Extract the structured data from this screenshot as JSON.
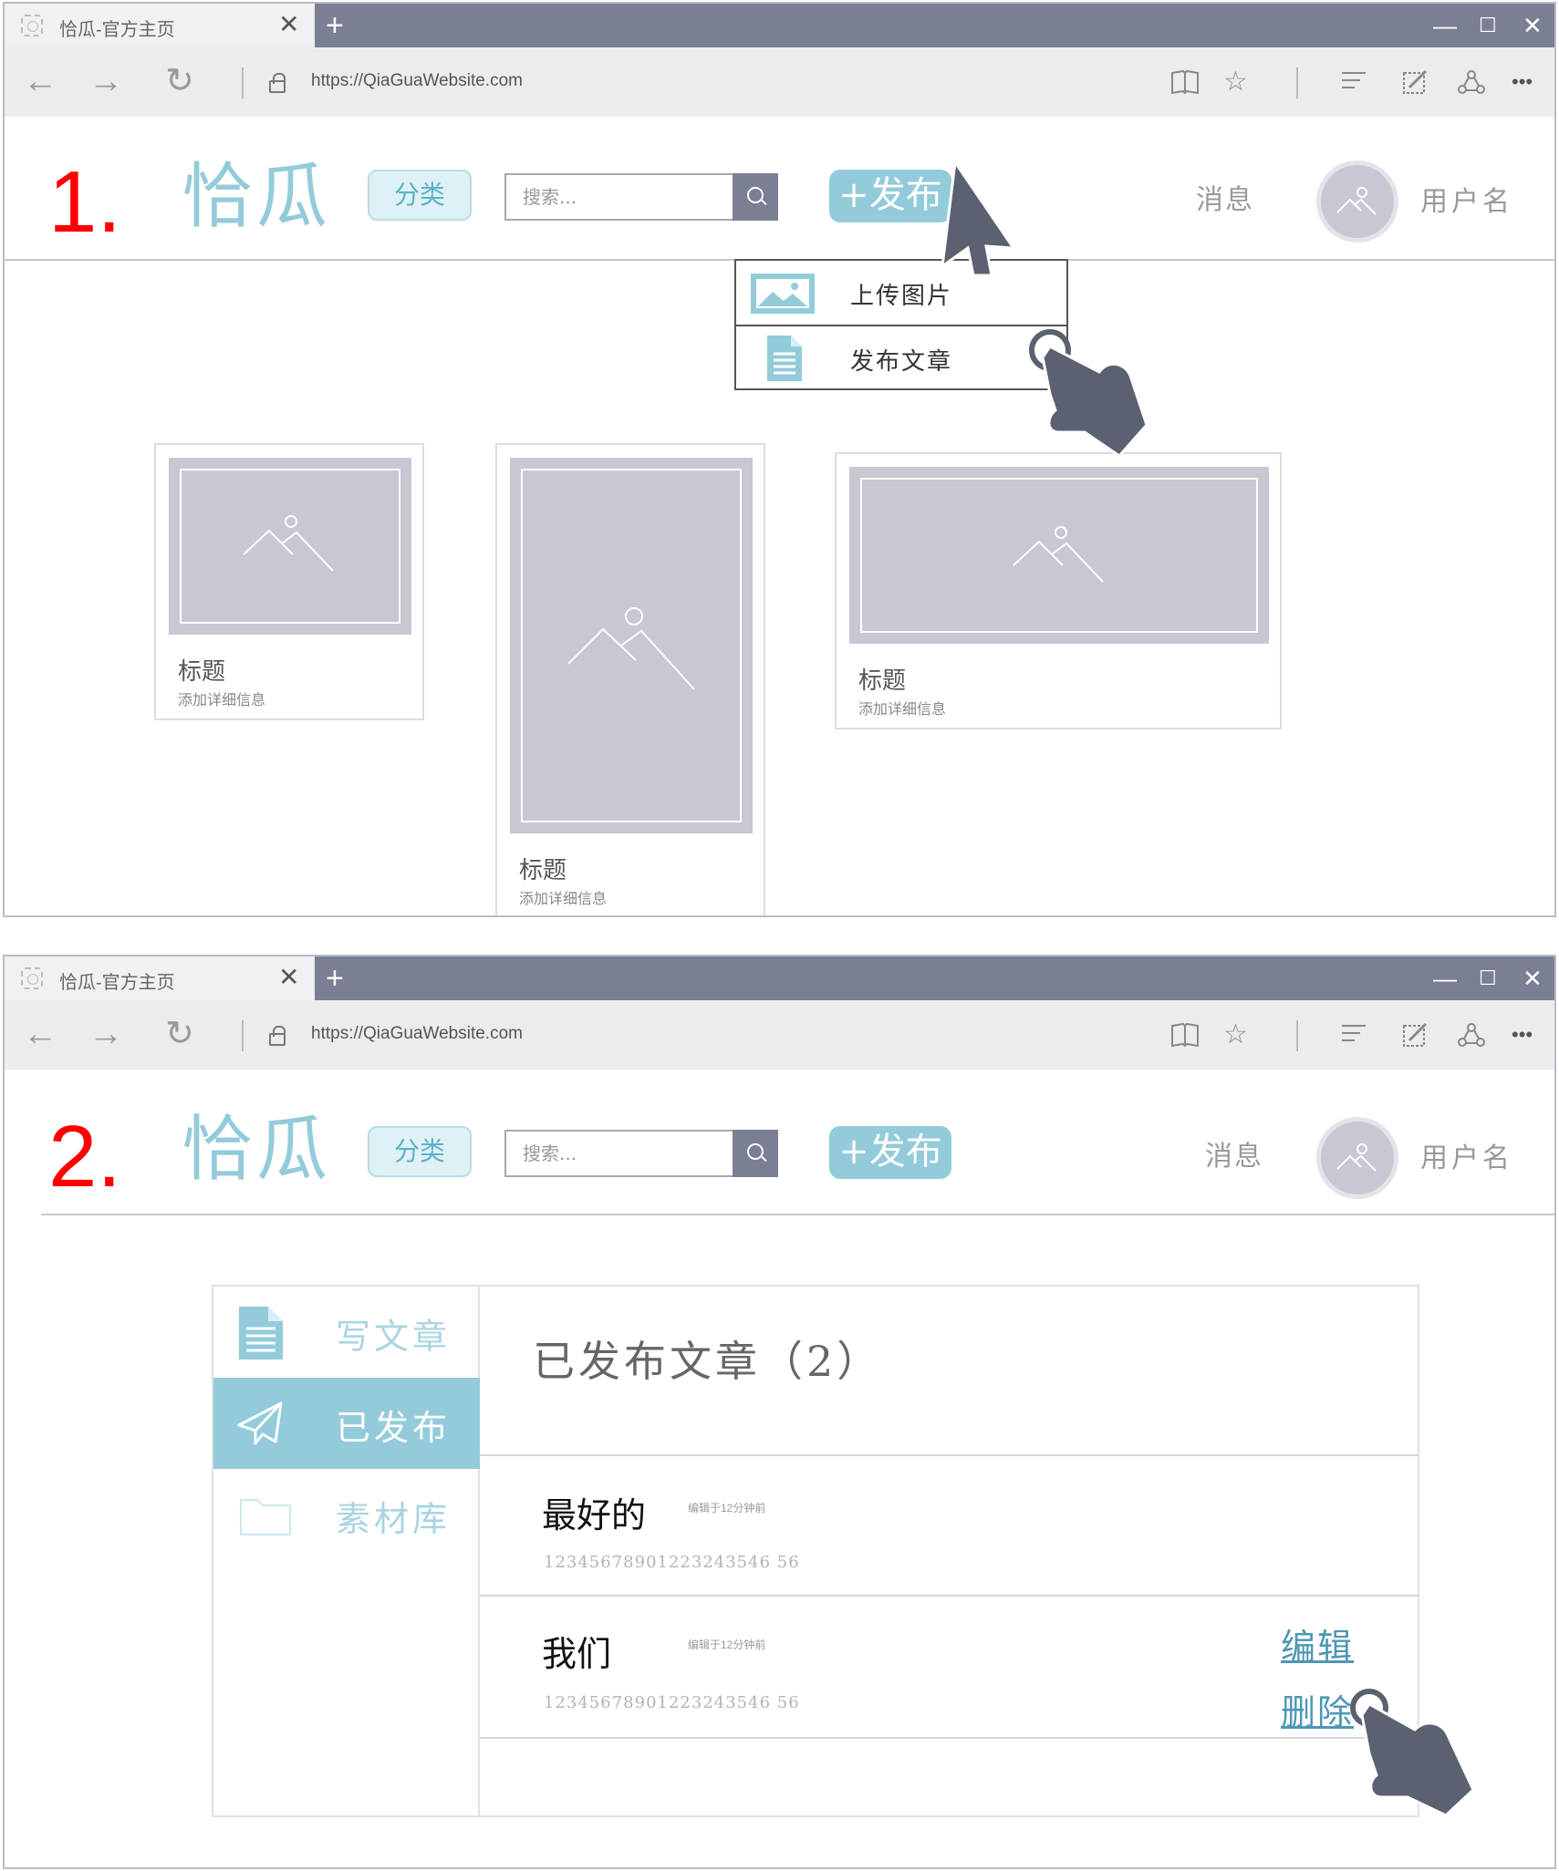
{
  "browser": {
    "tab_title": "恰瓜-官方主页",
    "tab_close": "✕",
    "new_tab": "+",
    "minimize": "—",
    "maximize": "☐",
    "close": "✕",
    "back": "←",
    "forward": "→",
    "refresh": "↻",
    "url": "https://QiaGuaWebsite.com",
    "favorite": "☆",
    "more": "•••"
  },
  "header": {
    "logo": "恰瓜",
    "category": "分类",
    "search_placeholder": "搜索...",
    "publish": "+发布",
    "messages": "消息",
    "username": "用户名"
  },
  "screen1": {
    "step": "1.",
    "dropdown": [
      {
        "label": "上传图片",
        "icon": "image-icon"
      },
      {
        "label": "发布文章",
        "icon": "document-icon"
      }
    ],
    "cards": [
      {
        "title": "标题",
        "desc": "添加详细信息"
      },
      {
        "title": "标题",
        "desc": "添加详细信息"
      },
      {
        "title": "标题",
        "desc": "添加详细信息"
      }
    ]
  },
  "screen2": {
    "step": "2.",
    "sidebar": [
      {
        "label": "写文章",
        "icon": "document-icon"
      },
      {
        "label": "已发布",
        "icon": "paper-plane-icon"
      },
      {
        "label": "素材库",
        "icon": "folder-icon"
      }
    ],
    "main_title": "已发布文章（2）",
    "articles": [
      {
        "title": "最好的",
        "time": "编辑于12分钟前",
        "body": "12345678901223243546 56"
      },
      {
        "title": "我们",
        "time": "编辑于12分钟前",
        "body": "12345678901223243546 56",
        "edit": "编辑",
        "delete": "删除"
      }
    ]
  },
  "colors": {
    "accent": "#93cbda",
    "tabbar": "#7a7f94",
    "placeholder_gray": "#c6c9d2",
    "step_red": "#ff0000",
    "cursor": "#5b6170"
  }
}
